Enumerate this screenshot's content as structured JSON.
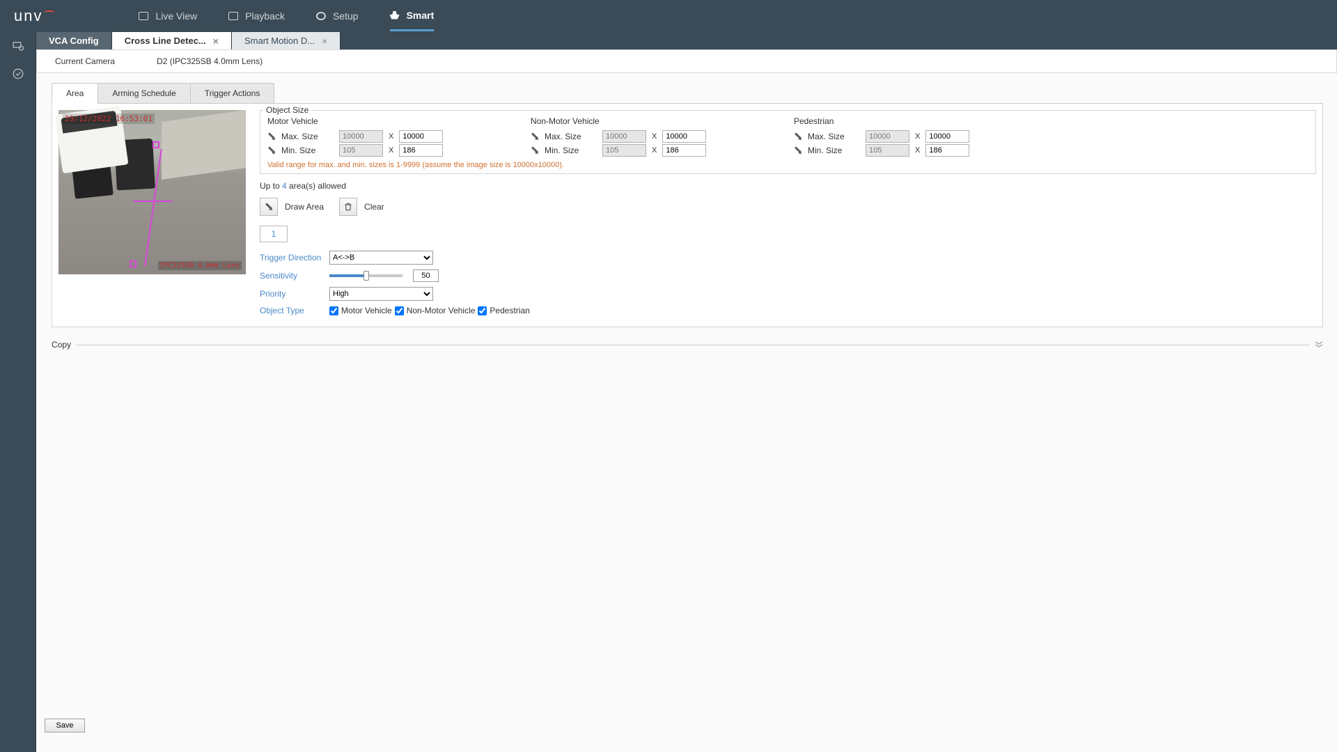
{
  "brand": "unv",
  "nav": {
    "live_view": "Live View",
    "playback": "Playback",
    "setup": "Setup",
    "smart": "Smart"
  },
  "tabs": {
    "vca_config": "VCA Config",
    "cross_line": "Cross Line Detec...",
    "smart_motion": "Smart Motion D..."
  },
  "camera": {
    "label": "Current Camera",
    "value": "D2 (IPC325SB 4.0mm Lens)"
  },
  "sub_tabs": {
    "area": "Area",
    "arming": "Arming Schedule",
    "trigger": "Trigger Actions"
  },
  "preview": {
    "timestamp": "29/12/2022 16:53:01",
    "cam_label": "IPC325SB 4.0mm Lens"
  },
  "object_size": {
    "legend": "Object Size",
    "hint": "Valid range for max. and min. sizes is 1-9999 (assume the image size is 10000x10000).",
    "max_label": "Max. Size",
    "min_label": "Min. Size",
    "x_sep": "X",
    "cols": [
      {
        "title": "Motor Vehicle",
        "max_w": "10000",
        "max_h": "10000",
        "min_w": "105",
        "min_h": "186"
      },
      {
        "title": "Non-Motor Vehicle",
        "max_w": "10000",
        "max_h": "10000",
        "min_w": "105",
        "min_h": "186"
      },
      {
        "title": "Pedestrian",
        "max_w": "10000",
        "max_h": "10000",
        "min_w": "105",
        "min_h": "186"
      }
    ]
  },
  "areas": {
    "prefix": "Up to ",
    "count": "4",
    "suffix": " area(s) allowed"
  },
  "buttons": {
    "draw_area": "Draw Area",
    "clear": "Clear",
    "save": "Save"
  },
  "area_tab": "1",
  "form": {
    "trigger_dir_label": "Trigger Direction",
    "trigger_dir_value": "A<->B",
    "sensitivity_label": "Sensitivity",
    "sensitivity_value": "50",
    "priority_label": "Priority",
    "priority_value": "High",
    "object_type_label": "Object Type",
    "obj_motor": "Motor Vehicle",
    "obj_nonmotor": "Non-Motor Vehicle",
    "obj_pedestrian": "Pedestrian"
  },
  "copy": {
    "label": "Copy"
  }
}
